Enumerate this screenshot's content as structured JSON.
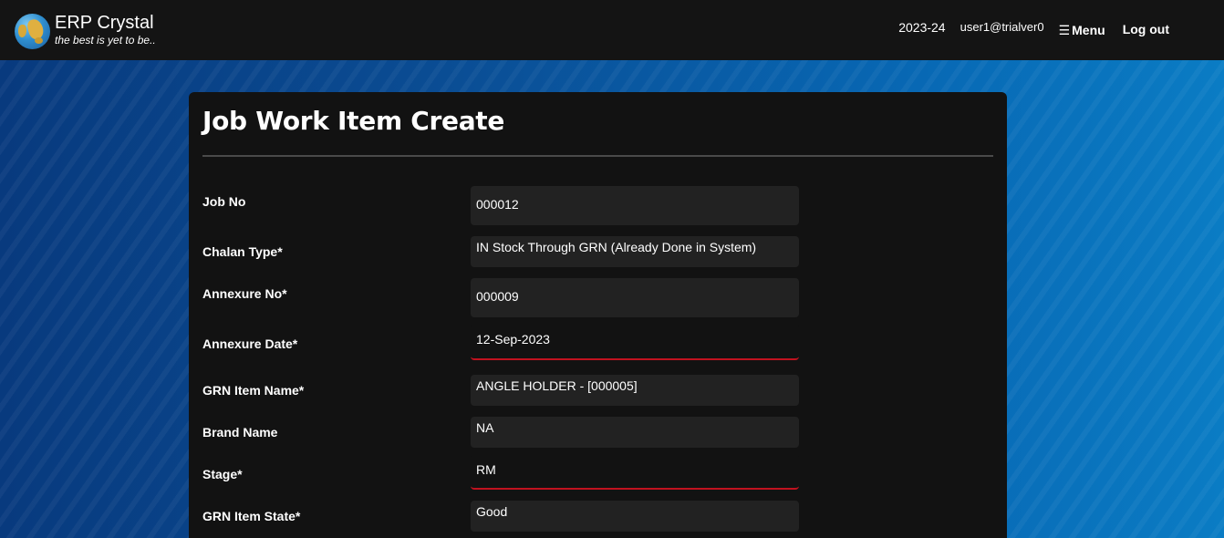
{
  "header": {
    "app_name": "ERP Crystal",
    "tagline": "the best is yet to be..",
    "logo_icon": "globe-icon",
    "financial_year": "2023-24",
    "user": "user1@trialver0",
    "menu_label": "Menu",
    "menu_icon": "hamburger-icon",
    "logout_label": "Log out"
  },
  "form": {
    "title": "Job Work Item Create",
    "fields": [
      {
        "label": "Job No",
        "value": "000012",
        "invalid": false
      },
      {
        "label": "Chalan Type*",
        "value": "IN Stock Through GRN (Already Done in System)",
        "invalid": false
      },
      {
        "label": "Annexure No*",
        "value": "000009",
        "invalid": false
      },
      {
        "label": "Annexure Date*",
        "value": "12-Sep-2023",
        "invalid": true
      },
      {
        "label": "GRN Item Name*",
        "value": "ANGLE HOLDER - [000005]",
        "invalid": false
      },
      {
        "label": "Brand Name",
        "value": "NA",
        "invalid": false
      },
      {
        "label": "Stage*",
        "value": "RM",
        "invalid": true
      },
      {
        "label": "GRN Item State*",
        "value": "Good",
        "invalid": false
      }
    ]
  },
  "colors": {
    "topbar": "#141414",
    "card": "#121212",
    "field_bg": "#222222",
    "error_underline": "#c1121f",
    "background_blue": "#0a57a2"
  }
}
